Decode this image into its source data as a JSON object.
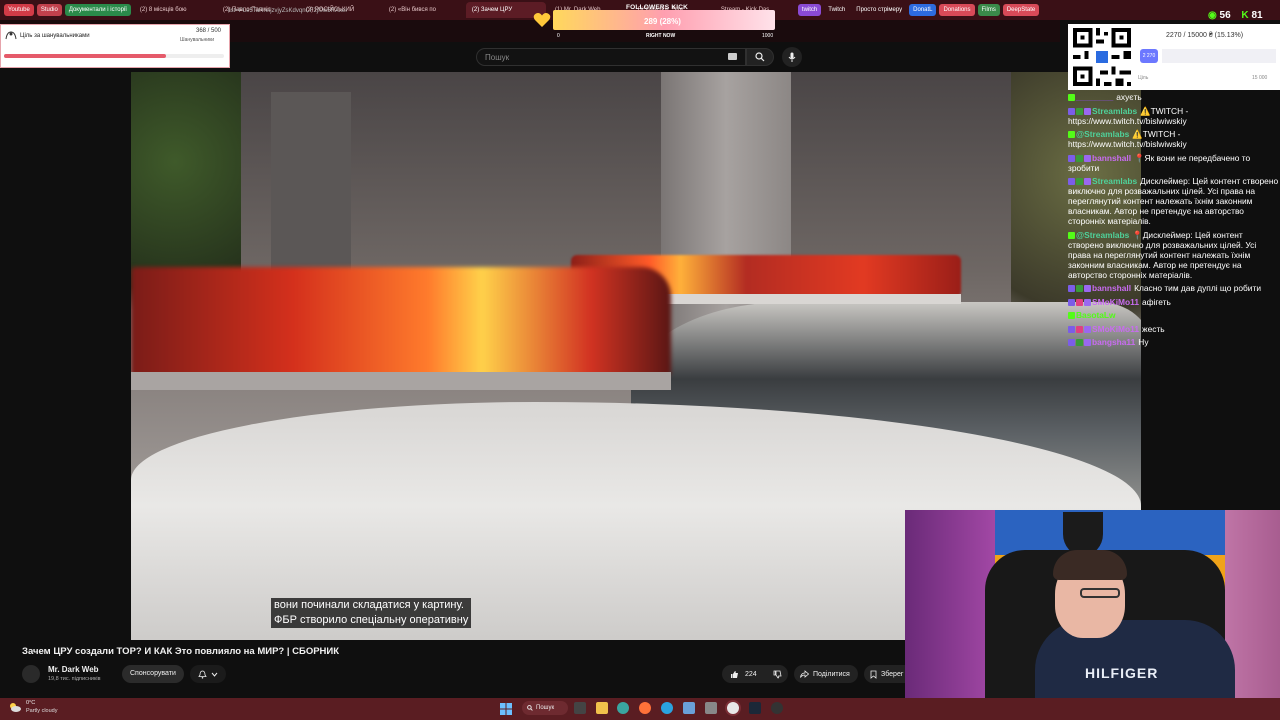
{
  "browser": {
    "pinned": [
      {
        "label": "Youtube",
        "color": "#d23b47"
      },
      {
        "label": "Studio",
        "color": "#c2414d"
      },
      {
        "label": "Документали і історії",
        "color": "#2a8a4a"
      }
    ],
    "tabs": [
      {
        "label": "(2) 8 місяців бою",
        "active": false
      },
      {
        "label": "(2) Павло Пашкіс",
        "active": false
      },
      {
        "label": "(2) РОСІЙСЬКИЙ",
        "active": false
      },
      {
        "label": "(2) «Він бився по",
        "active": false
      },
      {
        "label": "(2) Зачем ЦРУ",
        "active": true
      },
      {
        "label": "(1) Mr. Dark Web",
        "active": false
      },
      {
        "label": "BiSlwiwskiy_Stre",
        "active": false
      },
      {
        "label": "Stream - Kick Das",
        "active": false
      }
    ],
    "right_pinned": [
      {
        "label": "twitch",
        "color": "#8a4ad4"
      },
      {
        "label": "Twitch",
        "color": "transparent"
      },
      {
        "label": "Просто стрімеру",
        "color": "transparent"
      },
      {
        "label": "DonatL",
        "color": "#2d6be0"
      },
      {
        "label": "Donations",
        "color": "#d84a58"
      },
      {
        "label": "Films",
        "color": "#3a8a4a"
      },
      {
        "label": "DeepState",
        "color": "#d84a58"
      }
    ],
    "url": "list=PLe5TaRreijzvjyZsKdvqnCF2jl0w5RXxeI"
  },
  "youtube": {
    "search_placeholder": "Пошук",
    "caption_line1": "вони починали складатися у картину.",
    "caption_line2": "ФБР створило спеціальну оперативну",
    "video_title": "Зачем ЦРУ создали TOP? И КАК Это повлияло на МИР? | СБОРНИК",
    "channel_name": "Mr. Dark Web",
    "subscribers": "19,8 тис. підписників",
    "sponsor_label": "Спонсорувати",
    "like_count": "224",
    "share_label": "Поділитися",
    "save_label": "Зберег"
  },
  "goal_widget": {
    "title": "Ціль за шанувальниками",
    "count": "368 / 500",
    "unit": "Шанувальники",
    "progress": 0.736
  },
  "follow_widget": {
    "title": "FOLLOWERS KICK",
    "count": "289 (28%)",
    "min": "0",
    "label": "RIGHT NOW",
    "max": "1000",
    "progress": 0.289
  },
  "donation_widget": {
    "count": "2270 / 15000 ₴ (15.13%)",
    "badge": "2 270",
    "min_label": "Ціль",
    "max_label": "15 000",
    "progress": 0.1513
  },
  "kick_stats": {
    "viewers": "56",
    "followers": "81"
  },
  "chat": [
    {
      "user": "________",
      "user_color": "#8f4ef0",
      "text": "ахуєть",
      "badges": [
        "#53fc18"
      ]
    },
    {
      "user": "Streamlabs",
      "user_color": "#4fd19a",
      "text": "⚠️TWITCH - https://www.twitch.tv/bislwiwskiy",
      "badges": [
        "#7b5de8",
        "#3a9b3a",
        "#9a68f0"
      ]
    },
    {
      "user": "@Streamlabs",
      "user_color": "#4fd19a",
      "text": "⚠️TWITCH - https://www.twitch.tv/bislwiwskiy",
      "badges": [
        "#53fc18"
      ]
    },
    {
      "user": "bannshall",
      "user_color": "#c86cf0",
      "text": "📍Як вони не передбачено то зробити",
      "badges": [
        "#7b5de8",
        "#3a9b3a",
        "#9a68f0"
      ]
    },
    {
      "user": "Streamlabs",
      "user_color": "#4fd19a",
      "text": "Дисклеймер: Цей контент створено виключно для розважальних цілей. Усі права на переглянутий контент належать їхнім законним власникам. Автор не претендує на авторство сторонніх матеріалів.",
      "badges": [
        "#7b5de8",
        "#3a9b3a",
        "#9a68f0"
      ]
    },
    {
      "user": "@Streamlabs",
      "user_color": "#4fd19a",
      "text": "📍Дисклеймер: Цей контент створено виключно для розважальних цілей. Усі права на переглянутий контент належать їхнім законним власникам. Автор не претендує на авторство сторонніх матеріалів.",
      "badges": [
        "#53fc18"
      ]
    },
    {
      "user": "bannshall",
      "user_color": "#c86cf0",
      "text": "Класно тим дав дуплі що робити",
      "badges": [
        "#7b5de8",
        "#3a9b3a",
        "#9a68f0"
      ]
    },
    {
      "user": "SMoKiMo11",
      "user_color": "#c86cf0",
      "text": "афігеть",
      "badges": [
        "#7b5de8",
        "#e04080",
        "#9a68f0"
      ]
    },
    {
      "user": "BasotaLw",
      "user_color": "#53fc18",
      "text": "",
      "badges": [
        "#53fc18"
      ]
    },
    {
      "user": "SMoKiMo11",
      "user_color": "#c86cf0",
      "text": "жесть",
      "badges": [
        "#7b5de8",
        "#e04080",
        "#9a68f0"
      ]
    },
    {
      "user": "bangsha11",
      "user_color": "#c86cf0",
      "text": "Ну",
      "badges": [
        "#7b5de8",
        "#3a9b3a",
        "#9a68f0"
      ]
    }
  ],
  "taskbar": {
    "temperature": "0°C",
    "weather": "Partly cloudy",
    "search_label": "Пошук"
  },
  "webcam": {
    "shirt_text": "HILFIGER"
  },
  "colors": {
    "taskbar": "#5a1d22",
    "tabbar": "#3a1016",
    "kick_green": "#53fc18",
    "goal_fill": "#e55a6a"
  }
}
